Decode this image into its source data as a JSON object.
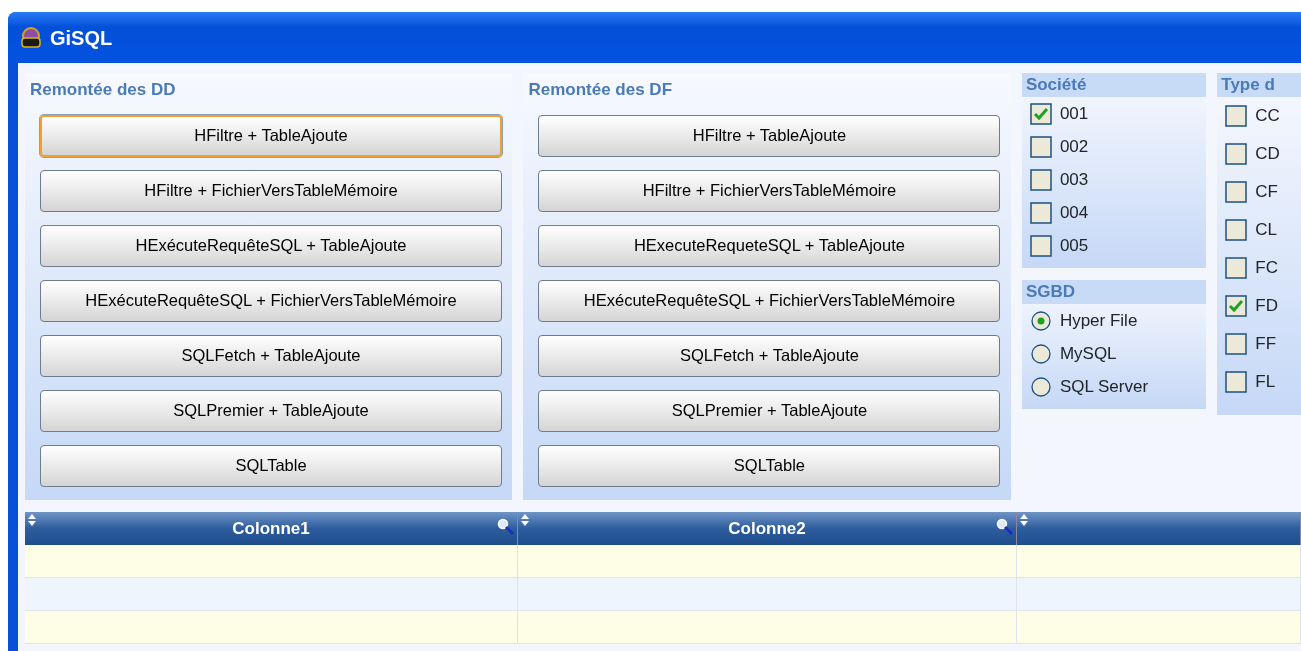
{
  "window": {
    "title": "GiSQL"
  },
  "button_panels": [
    {
      "title": "Remontée des DD",
      "buttons": [
        {
          "label": "HFiltre + TableAjoute",
          "focused": true
        },
        {
          "label": "HFiltre + FichierVersTableMémoire",
          "focused": false
        },
        {
          "label": "HExécuteRequêteSQL + TableAjoute",
          "focused": false
        },
        {
          "label": "HExécuteRequêteSQL + FichierVersTableMémoire",
          "focused": false
        },
        {
          "label": "SQLFetch + TableAjoute",
          "focused": false
        },
        {
          "label": "SQLPremier + TableAjoute",
          "focused": false
        },
        {
          "label": "SQLTable",
          "focused": false
        }
      ]
    },
    {
      "title": "Remontée des DF",
      "buttons": [
        {
          "label": "HFiltre + TableAjoute",
          "focused": false
        },
        {
          "label": "HFiltre + FichierVersTableMémoire",
          "focused": false
        },
        {
          "label": "HExecuteRequeteSQL + TableAjoute",
          "focused": false
        },
        {
          "label": "HExécuteRequêteSQL + FichierVersTableMémoire",
          "focused": false
        },
        {
          "label": "SQLFetch + TableAjoute",
          "focused": false
        },
        {
          "label": "SQLPremier + TableAjoute",
          "focused": false
        },
        {
          "label": "SQLTable",
          "focused": false
        }
      ]
    }
  ],
  "societe": {
    "title": "Société",
    "items": [
      {
        "label": "001",
        "checked": true
      },
      {
        "label": "002",
        "checked": false
      },
      {
        "label": "003",
        "checked": false
      },
      {
        "label": "004",
        "checked": false
      },
      {
        "label": "005",
        "checked": false
      }
    ]
  },
  "sgbd": {
    "title": "SGBD",
    "options": [
      {
        "label": "Hyper File",
        "selected": true
      },
      {
        "label": "MySQL",
        "selected": false
      },
      {
        "label": "SQL Server",
        "selected": false
      }
    ]
  },
  "type": {
    "title": "Type d",
    "items": [
      {
        "label": "CC",
        "checked": false
      },
      {
        "label": "CD",
        "checked": false
      },
      {
        "label": "CF",
        "checked": false
      },
      {
        "label": "CL",
        "checked": false
      },
      {
        "label": "FC",
        "checked": false
      },
      {
        "label": "FD",
        "checked": true
      },
      {
        "label": "FF",
        "checked": false
      },
      {
        "label": "FL",
        "checked": false
      }
    ]
  },
  "table": {
    "columns": [
      {
        "label": "Colonne1",
        "searchable": true
      },
      {
        "label": "Colonne2",
        "searchable": true
      },
      {
        "searchable": false
      }
    ]
  }
}
